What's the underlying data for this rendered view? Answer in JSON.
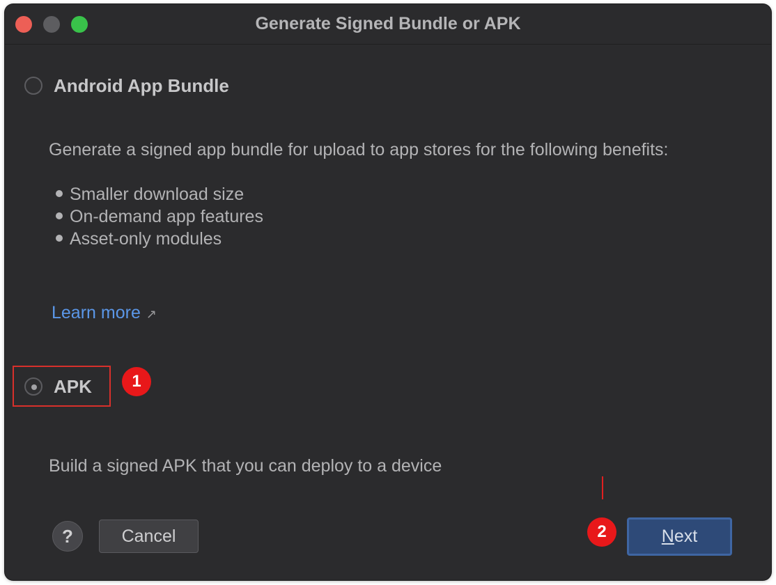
{
  "window": {
    "title": "Generate Signed Bundle or APK"
  },
  "options": {
    "bundle": {
      "label": "Android App Bundle",
      "selected": false,
      "description": "Generate a signed app bundle for upload to app stores for the following benefits:",
      "benefits": [
        "Smaller download size",
        "On-demand app features",
        "Asset-only modules"
      ],
      "learn_more": "Learn more",
      "link_icon": "external-link-arrow-icon"
    },
    "apk": {
      "label": "APK",
      "selected": true,
      "description": "Build a signed APK that you can deploy to a device"
    }
  },
  "annotations": {
    "step1": "1",
    "step2": "2",
    "color": "#e8181a"
  },
  "footer": {
    "help_label": "?",
    "cancel_label": "Cancel",
    "next_mnemonic": "N",
    "next_rest": "ext"
  },
  "colors": {
    "background": "#2b2b2d",
    "link": "#5b97e8",
    "primary_button": "#2e4a78"
  }
}
